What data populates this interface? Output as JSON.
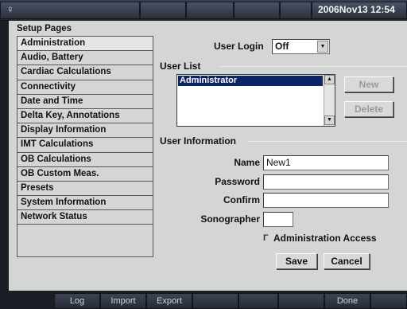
{
  "status_bar": {
    "logo_icon": "ultrasound-probe-icon",
    "datetime": "2006Nov13  12:54"
  },
  "setup_pages": {
    "title": "Setup Pages",
    "items": [
      {
        "label": "Administration",
        "selected": true
      },
      {
        "label": "Audio, Battery"
      },
      {
        "label": "Cardiac Calculations"
      },
      {
        "label": "Connectivity"
      },
      {
        "label": "Date and Time"
      },
      {
        "label": "Delta Key, Annotations"
      },
      {
        "label": "Display Information"
      },
      {
        "label": "IMT Calculations"
      },
      {
        "label": "OB Calculations"
      },
      {
        "label": "OB Custom Meas."
      },
      {
        "label": "Presets"
      },
      {
        "label": "System Information"
      },
      {
        "label": "Network Status"
      }
    ]
  },
  "user_login": {
    "label": "User Login",
    "value": "Off"
  },
  "user_list": {
    "title": "User List",
    "items": [
      "Administrator"
    ],
    "new_label": "New",
    "delete_label": "Delete"
  },
  "user_information": {
    "title": "User Information",
    "name_label": "Name",
    "name_value": "New1",
    "password_label": "Password",
    "password_value": "",
    "confirm_label": "Confirm",
    "confirm_value": "",
    "sonographer_label": "Sonographer",
    "sonographer_value": "",
    "admin_access_label": "Administration Access",
    "admin_access_checked": false,
    "save_label": "Save",
    "cancel_label": "Cancel"
  },
  "softkeys": [
    "Log",
    "Import",
    "Export",
    "",
    "",
    "",
    "Done",
    ""
  ]
}
